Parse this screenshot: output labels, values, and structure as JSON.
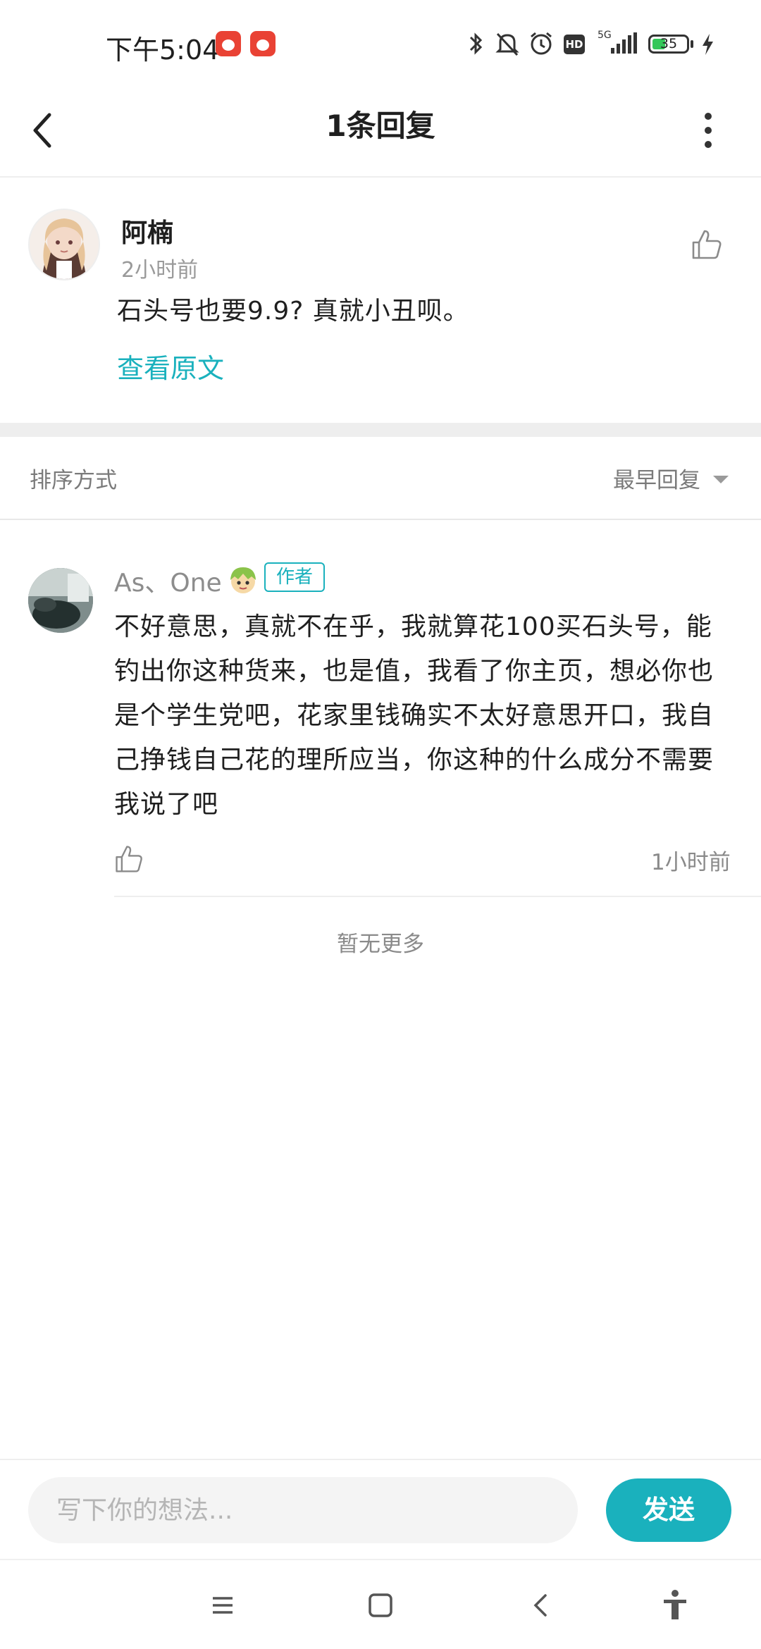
{
  "status_bar": {
    "time": "下午5:04",
    "battery_level": "35",
    "icons": [
      "app-badge-icon",
      "app-badge-icon",
      "bluetooth-icon",
      "mute-icon",
      "alarm-icon",
      "hd-icon",
      "signal-5g-icon",
      "battery-icon",
      "charging-icon"
    ],
    "hd_label": "HD",
    "network_label": "5G"
  },
  "nav_bar": {
    "title": "1条回复"
  },
  "original_comment": {
    "author": "阿楠",
    "time": "2小时前",
    "text": "石头号也要9.9? 真就小丑呗。",
    "view_original_label": "查看原文"
  },
  "sort_bar": {
    "label": "排序方式",
    "selected": "最早回复"
  },
  "reply": {
    "author": "As、One",
    "badge": "作者",
    "text": "不好意思，真就不在乎，我就算花100买石头号，能钓出你这种货来，也是值，我看了你主页，想必你也是个学生党吧，花家里钱确实不太好意思开口，我自己挣钱自己花的理所应当，你这种的什么成分不需要我说了吧",
    "time": "1小时前"
  },
  "footer": {
    "no_more": "暂无更多"
  },
  "input_bar": {
    "placeholder": "写下你的想法...",
    "send_label": "发送"
  },
  "colors": {
    "accent": "#1ab1bd",
    "muted_text": "#8a8a8a",
    "divider": "#eeeeee"
  }
}
